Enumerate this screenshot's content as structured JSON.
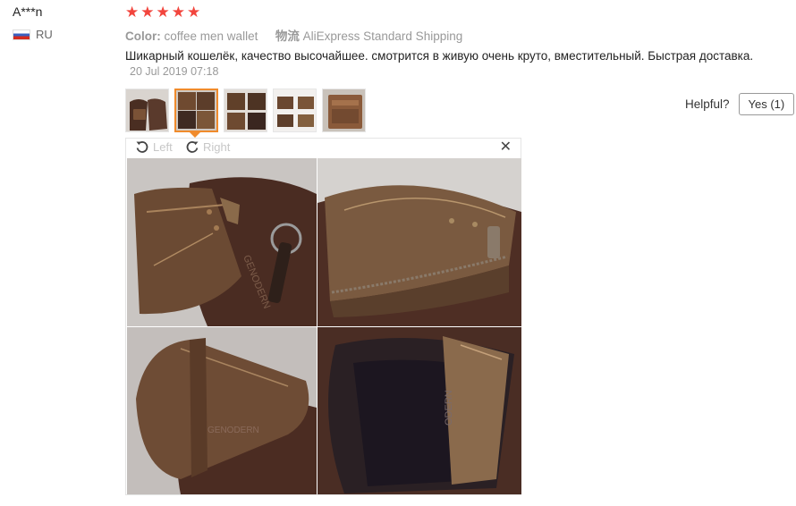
{
  "reviewer": {
    "name": "A***n",
    "country": "RU"
  },
  "rating": {
    "stars": 5,
    "star_glyph": "★"
  },
  "meta": {
    "color_label": "Color:",
    "color_value": "coffee men wallet",
    "shipping_label": "物流",
    "shipping_value": "AliExpress Standard Shipping"
  },
  "review": {
    "text": "Шикарный кошелёк, качество высочайшее. смотрится в живую очень круто, вместительный. Быстрая доставка.",
    "date": "20 Jul 2019 07:18"
  },
  "helpful": {
    "label": "Helpful?",
    "yes_label": "Yes (1)"
  },
  "viewer": {
    "rotate_left_label": "Left",
    "rotate_right_label": "Right",
    "close_glyph": "✕"
  },
  "thumbnails": {
    "count": 5,
    "selected_index": 1
  },
  "colors": {
    "star": "#f2453d",
    "active_thumb_border": "#f08b2c",
    "muted_text": "#999999"
  }
}
